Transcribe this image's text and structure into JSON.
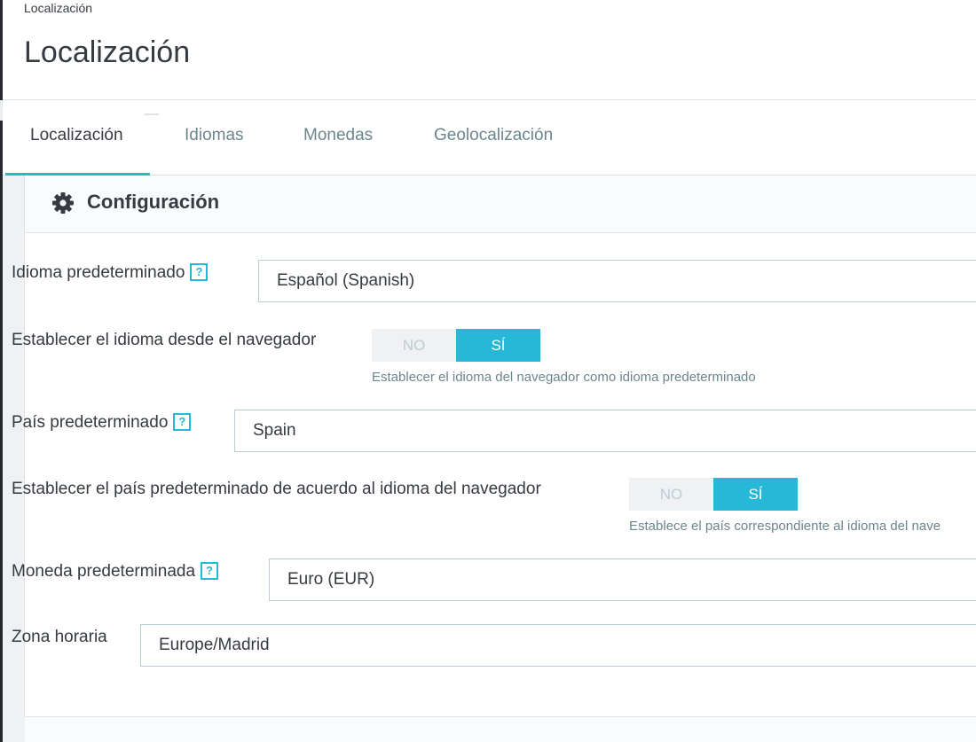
{
  "header": {
    "breadcrumb": "Localización",
    "title": "Localización"
  },
  "tabs": [
    {
      "label": "Localización",
      "active": true
    },
    {
      "label": "Idiomas",
      "active": false
    },
    {
      "label": "Monedas",
      "active": false
    },
    {
      "label": "Geolocalización",
      "active": false
    }
  ],
  "panel": {
    "icon": "gear-icon",
    "title": "Configuración"
  },
  "form": {
    "default_language": {
      "label": "Idioma predeterminado",
      "help": "?",
      "value": "Español (Spanish)"
    },
    "browser_language": {
      "label": "Establecer el idioma desde el navegador",
      "no": "NO",
      "yes": "SÍ",
      "selected": "SÍ",
      "hint": "Establecer el idioma del navegador como idioma predeterminado"
    },
    "default_country": {
      "label": "País predeterminado",
      "help": "?",
      "value": "Spain"
    },
    "browser_country": {
      "label": "Establecer el país predeterminado de acuerdo al idioma del navegador",
      "no": "NO",
      "yes": "SÍ",
      "selected": "SÍ",
      "hint": "Establece el país correspondiente al idioma del nave"
    },
    "default_currency": {
      "label": "Moneda predeterminada",
      "help": "?",
      "value": "Euro (EUR)"
    },
    "timezone": {
      "label": "Zona horaria",
      "value": "Europe/Madrid"
    }
  },
  "colors": {
    "accent": "#25b9d7",
    "text": "#363a41",
    "muted": "#6c868e",
    "border": "#bbcdd2",
    "background": "#eff1f2"
  }
}
